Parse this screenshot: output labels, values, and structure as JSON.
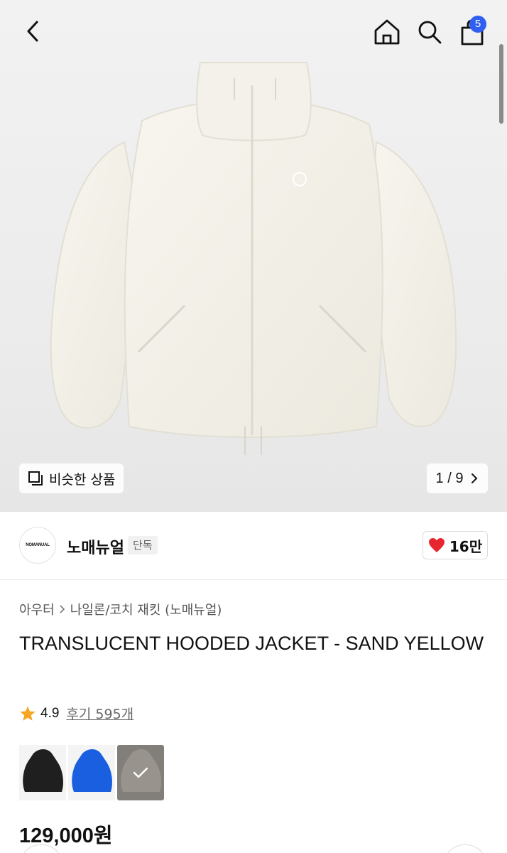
{
  "header": {
    "cart_count": "5"
  },
  "hero": {
    "similar_label": "비슷한 상품",
    "page_current": "1",
    "page_sep": "/",
    "page_total": "9"
  },
  "brand": {
    "logo_text": "NOMANUAL",
    "name": "노매뉴얼",
    "tag": "단독",
    "likes": "16만"
  },
  "product": {
    "breadcrumb": [
      "아우터",
      "나일론/코치 재킷 (노매뉴얼)"
    ],
    "title": "TRANSLUCENT HOODED JACKET - SAND YELLOW",
    "rating": "4.9",
    "reviews": "후기 595개",
    "price": "129,000원"
  },
  "colors": [
    {
      "name": "black",
      "hex": "#1f1f1f",
      "selected": false
    },
    {
      "name": "blue",
      "hex": "#1a5fe0",
      "selected": false
    },
    {
      "name": "sand",
      "hex": "#c9c3b8",
      "selected": true
    }
  ],
  "icons": [
    "back-arrow-icon",
    "home-icon",
    "search-icon",
    "shopping-bag-icon",
    "similar-products-icon",
    "chevron-right-icon",
    "heart-icon",
    "star-icon",
    "check-icon"
  ]
}
